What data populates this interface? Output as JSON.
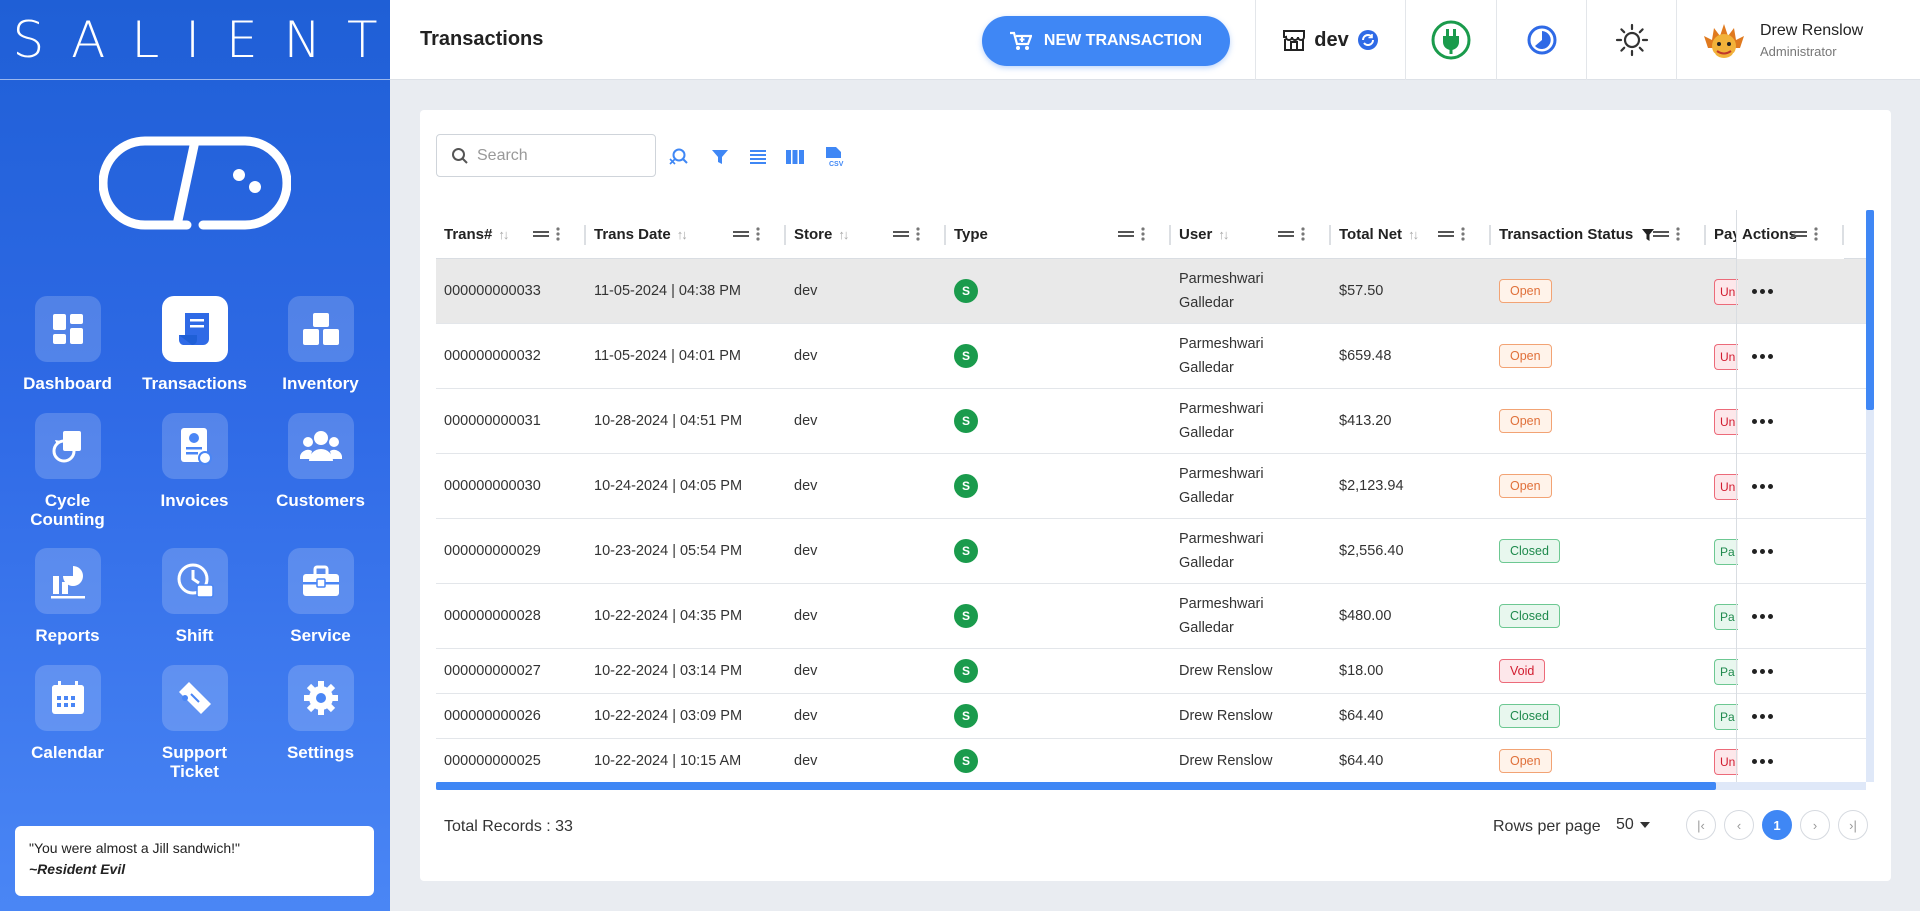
{
  "app": {
    "brand": "SALIENT"
  },
  "sidebar": {
    "items": [
      {
        "label": "Dashboard",
        "icon": "dashboard-icon"
      },
      {
        "label": "Transactions",
        "icon": "receipt-icon",
        "active": true
      },
      {
        "label": "Inventory",
        "icon": "boxes-icon"
      },
      {
        "label": "Cycle Counting",
        "icon": "cycle-count-icon"
      },
      {
        "label": "Invoices",
        "icon": "invoice-icon"
      },
      {
        "label": "Customers",
        "icon": "customers-icon"
      },
      {
        "label": "Reports",
        "icon": "reports-icon"
      },
      {
        "label": "Shift",
        "icon": "shift-icon"
      },
      {
        "label": "Service",
        "icon": "toolbox-icon"
      },
      {
        "label": "Calendar",
        "icon": "calendar-icon"
      },
      {
        "label": "Support Ticket",
        "icon": "ticket-icon"
      },
      {
        "label": "Settings",
        "icon": "gear-icon"
      }
    ],
    "quote": {
      "text": "\"You were almost a Jill sandwich!\"",
      "source": "~Resident Evil"
    }
  },
  "header": {
    "title": "Transactions",
    "new_button": "NEW TRANSACTION",
    "store": "dev",
    "user": {
      "name": "Drew Renslow",
      "role": "Administrator"
    }
  },
  "toolbar": {
    "search_placeholder": "Search"
  },
  "table": {
    "columns": [
      "Trans#",
      "Trans Date",
      "Store",
      "Type",
      "User",
      "Total Net",
      "Transaction Status",
      "Pay",
      "Actions"
    ],
    "rows": [
      {
        "trans": "000000000033",
        "date": "11-05-2024 | 04:38 PM",
        "store": "dev",
        "type": "S",
        "user": "Parmeshwari Galledar",
        "total": "$57.50",
        "status": "Open",
        "pay": "Un"
      },
      {
        "trans": "000000000032",
        "date": "11-05-2024 | 04:01 PM",
        "store": "dev",
        "type": "S",
        "user": "Parmeshwari Galledar",
        "total": "$659.48",
        "status": "Open",
        "pay": "Un"
      },
      {
        "trans": "000000000031",
        "date": "10-28-2024 | 04:51 PM",
        "store": "dev",
        "type": "S",
        "user": "Parmeshwari Galledar",
        "total": "$413.20",
        "status": "Open",
        "pay": "Un"
      },
      {
        "trans": "000000000030",
        "date": "10-24-2024 | 04:05 PM",
        "store": "dev",
        "type": "S",
        "user": "Parmeshwari Galledar",
        "total": "$2,123.94",
        "status": "Open",
        "pay": "Un"
      },
      {
        "trans": "000000000029",
        "date": "10-23-2024 | 05:54 PM",
        "store": "dev",
        "type": "S",
        "user": "Parmeshwari Galledar",
        "total": "$2,556.40",
        "status": "Closed",
        "pay": "Pa"
      },
      {
        "trans": "000000000028",
        "date": "10-22-2024 | 04:35 PM",
        "store": "dev",
        "type": "S",
        "user": "Parmeshwari Galledar",
        "total": "$480.00",
        "status": "Closed",
        "pay": "Pa"
      },
      {
        "trans": "000000000027",
        "date": "10-22-2024 | 03:14 PM",
        "store": "dev",
        "type": "S",
        "user": "Drew Renslow",
        "total": "$18.00",
        "status": "Void",
        "pay": "Pa"
      },
      {
        "trans": "000000000026",
        "date": "10-22-2024 | 03:09 PM",
        "store": "dev",
        "type": "S",
        "user": "Drew Renslow",
        "total": "$64.40",
        "status": "Closed",
        "pay": "Pa"
      },
      {
        "trans": "000000000025",
        "date": "10-22-2024 | 10:15 AM",
        "store": "dev",
        "type": "S",
        "user": "Drew Renslow",
        "total": "$64.40",
        "status": "Open",
        "pay": "Un"
      }
    ]
  },
  "footer": {
    "total_records": "Total Records : 33",
    "rows_per_page_label": "Rows per page",
    "rows_per_page": "50",
    "page": "1"
  },
  "colors": {
    "accent": "#3f87f5",
    "sidebar": "#2f6ae6",
    "open": "#e0703a",
    "closed": "#1f8a4d",
    "void": "#d11b2e"
  }
}
